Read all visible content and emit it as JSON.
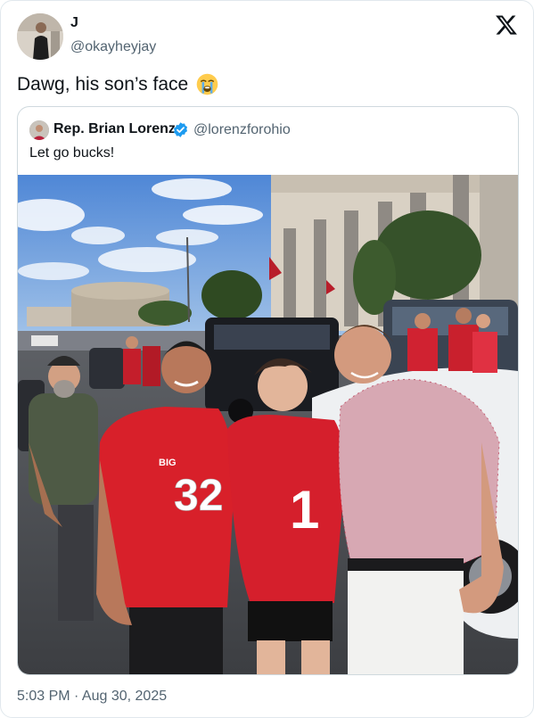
{
  "author": {
    "display_name": "J",
    "handle": "@okayheyjay"
  },
  "tweet": {
    "text": "Dawg, his son’s face",
    "emoji_icon": "loudly-crying-face-emoji"
  },
  "quoted": {
    "display_name": "Rep. Brian Lorenz",
    "verified_icon": "verified-badge-icon",
    "handle": "@lorenzforohio",
    "text": "Let go bucks!",
    "photo": {
      "jersey_numbers": [
        "32",
        "1"
      ],
      "jersey_logo": "BIG"
    }
  },
  "meta": {
    "timestamp": "5:03 PM · Aug 30, 2025"
  },
  "colors": {
    "accent_blue": "#1d9bf0",
    "scarlet": "#d8202a",
    "secondary_text": "#536471"
  }
}
